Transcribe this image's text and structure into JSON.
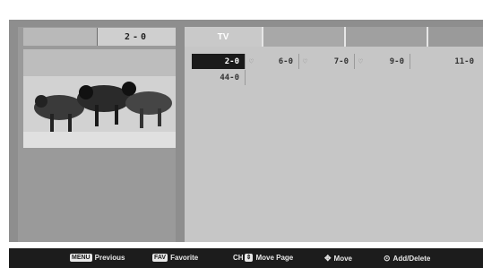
{
  "left_panel": {
    "channel_number": "2-0",
    "preview_icon": "tv-preview-image"
  },
  "tabs": [
    {
      "label": "TV"
    },
    {
      "label": ""
    },
    {
      "label": ""
    },
    {
      "label": ""
    }
  ],
  "channel_list": {
    "row1": [
      {
        "channel": "2-0",
        "selected": true,
        "mark": ""
      },
      {
        "channel": "6-0",
        "selected": false,
        "mark": "♡"
      },
      {
        "channel": "7-0",
        "selected": false,
        "mark": "♡"
      },
      {
        "channel": "9-0",
        "selected": false,
        "mark": "♡"
      },
      {
        "channel": "11-0",
        "selected": false,
        "mark": ""
      }
    ],
    "row2": [
      {
        "channel": "44-0",
        "selected": false,
        "mark": ""
      }
    ]
  },
  "footer": {
    "previous": {
      "key": "MENU",
      "label": "Previous"
    },
    "favorite": {
      "key": "FAV",
      "label": "Favorite"
    },
    "move_page": {
      "key": "CH",
      "label": "Move Page"
    },
    "move": {
      "icon": "dpad-icon",
      "label": "Move"
    },
    "add_delete": {
      "icon": "ok-button-icon",
      "label": "Add/Delete"
    }
  }
}
